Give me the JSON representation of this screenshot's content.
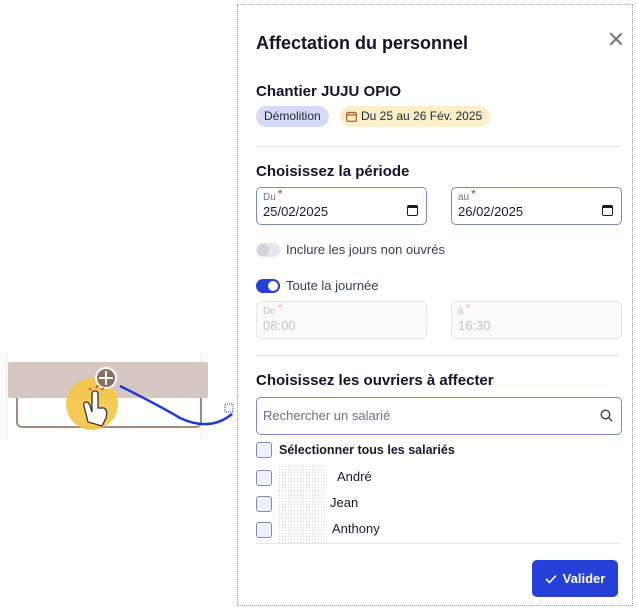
{
  "panel": {
    "title": "Affectation du personnel",
    "close_icon": "close-icon"
  },
  "site": {
    "name": "Chantier JUJU OPIO",
    "type_badge": "Démolition",
    "date_badge": "Du 25 au 26 Fév. 2025"
  },
  "period": {
    "title": "Choisissez la période",
    "start_label": "Du",
    "start_value": "25/02/2025",
    "end_label": "au",
    "end_value": "26/02/2025",
    "required_mark": "*",
    "include_non_working_label": "Inclure les jours non ouvrés",
    "include_non_working_on": false,
    "full_day_label": "Toute la journée",
    "full_day_on": true,
    "time_start_label": "De",
    "time_start_value": "08:00",
    "time_end_label": "à",
    "time_end_value": "16:30"
  },
  "workers": {
    "title": "Choisissez les ouvriers à affecter",
    "search_placeholder": "Rechercher un salarié",
    "select_all_label": "Sélectionner tous les salariés",
    "list": [
      {
        "name": "André",
        "checked": false
      },
      {
        "name": "Jean",
        "checked": false
      },
      {
        "name": "Anthony",
        "checked": false
      }
    ]
  },
  "footer": {
    "validate_label": "Valider"
  },
  "colors": {
    "accent": "#2540d6",
    "type_badge_bg": "#d6d9f5",
    "date_badge_bg": "#fcefc7",
    "cursor_highlight": "#f5c542"
  }
}
